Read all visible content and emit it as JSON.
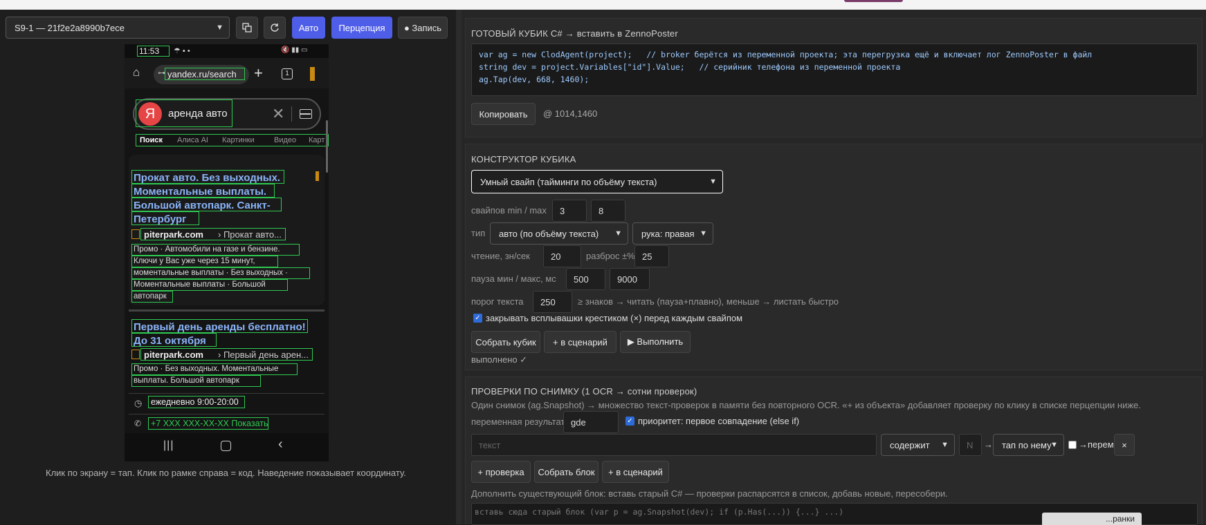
{
  "toolbar": {
    "device_select": "S9-1 — 21f2e2a8990b7ece",
    "btn_auto": "Авто",
    "btn_perception": "Перцепция",
    "btn_record": "● Запись"
  },
  "phone": {
    "time": "11:53",
    "url": "yandex.ru/search",
    "tab_count": "1",
    "search_query": "аренда авто",
    "yandex_letter": "Я",
    "tabs": [
      "Поиск",
      "Алиса AI",
      "Картинки",
      "Видео",
      "Карт"
    ],
    "result1": {
      "title_lines": [
        "Прокат авто. Без выходных.",
        "Моментальные выплаты.",
        "Большой автопарк. Санкт-",
        "Петербург"
      ],
      "domain": "piterpark.com",
      "path": "› Прокат авто...",
      "desc_lines": [
        "Промо · Автомобили на газе и бензине.",
        "Ключи у Вас уже через 15 минут,",
        "моментальные выплаты · Без выходных ·",
        "Моментальные выплаты · Большой",
        "автопарк"
      ]
    },
    "result2": {
      "title_lines": [
        "Первый день аренды бесплатно!",
        "До 31 октября"
      ],
      "domain": "piterpark.com",
      "path": "› Первый день арен...",
      "desc_lines": [
        "Промо · Без выходных. Моментальные",
        "выплаты. Большой автопарк"
      ]
    },
    "hours": "ежедневно 9:00-20:00",
    "phone_line": "+7 XXX XXX-XX-XX Показать"
  },
  "left_hint": "Клик по экрану = тап. Клик по рамке справа = код. Наведение показывает координату.",
  "ready_cube": {
    "title": "ГОТОВЫЙ КУБИК C# → вставить в ZennoPoster",
    "code_lines": [
      "var ag = new ClodAgent(project);   // broker берётся из переменной проекта; эта перегрузка ещё и включает лог ZennoPoster в файл",
      "string dev = project.Variables[\"id\"].Value;   // серийник телефона из переменной проекта",
      "ag.Tap(dev, 668, 1460);"
    ],
    "copy_btn": "Копировать",
    "coords": "@ 1014,1460"
  },
  "constructor": {
    "title": "КОНСТРУКТОР КУБИКА",
    "mode_select": "Умный свайп (тайминги по объёму текста)",
    "swipes_label": "свайпов min / max",
    "swipes_min": "3",
    "swipes_max": "8",
    "type_label": "тип",
    "type_select": "авто (по объёму текста)",
    "hand_select": "рука: правая",
    "read_label": "чтение, зн/сек",
    "read_value": "20",
    "spread_label": "разброс ±%",
    "spread_value": "25",
    "pause_label": "пауза мин / макс, мс",
    "pause_min": "500",
    "pause_max": "9000",
    "threshold_label": "порог текста",
    "threshold_value": "250",
    "threshold_hint": "≥ знаков → читать (пауза+плавно), меньше → листать быстро",
    "close_popups_label": "закрывать всплывашки крестиком (×) перед каждым свайпом",
    "btn_build": "Собрать кубик",
    "btn_to_scenario": "+ в сценарий",
    "btn_run": "▶ Выполнить",
    "status": "выполнено ✓"
  },
  "checks": {
    "title": "ПРОВЕРКИ ПО СНИМКУ (1 OCR → сотни проверок)",
    "description": "Один снимок (ag.Snapshot) → множество текст-проверок в памяти без повторного OCR. «+ из объекта» добавляет проверку по клику в списке перцепции ниже.",
    "result_var_label": "переменная результата",
    "result_var_value": "gde",
    "priority_label": "приоритет: первое совпадение (else if)",
    "text_placeholder": "текст",
    "match_select": "содержит",
    "n_placeholder": "N",
    "arrow": "→",
    "action_select": "тап по нему",
    "to_var_label": "→перем.",
    "remove": "×",
    "btn_add_check": "+ проверка",
    "btn_build_block": "Собрать блок",
    "btn_to_scenario": "+ в сценарий",
    "extend_hint": "Дополнить существующий блок: вставь старый C# — проверки распарсятся в список, добавь новые, пересобери.",
    "old_block_placeholder": "вставь сюда старый блок (var p = ag.Snapshot(dev); if (p.Has(...)) {...} ...)",
    "corner_btn": "...ранки"
  },
  "colors": {
    "accent_blue": "#4f5ee8",
    "ocr_box": "#2fcb52",
    "link_blue": "#8ab4f8"
  }
}
